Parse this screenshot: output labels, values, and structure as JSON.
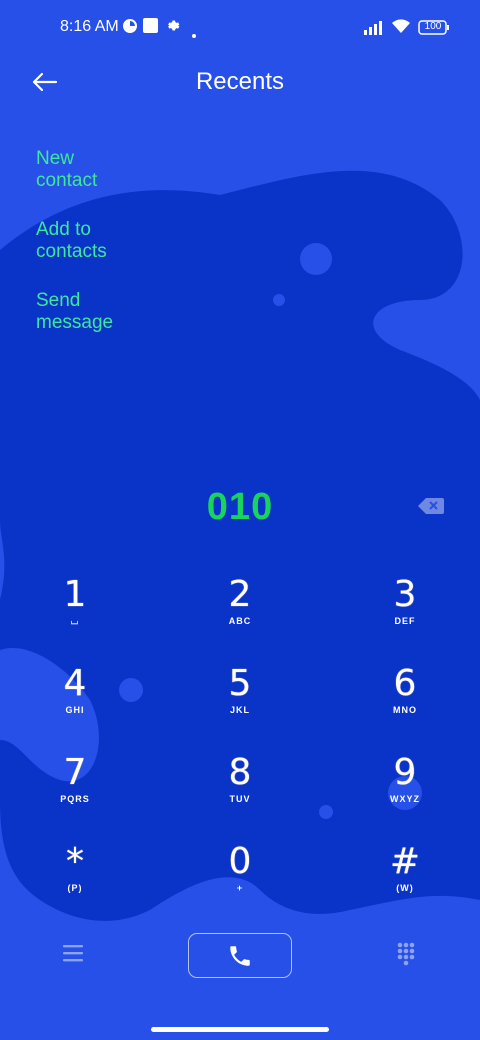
{
  "status_bar": {
    "time": "8:16 AM",
    "battery": "100"
  },
  "header": {
    "title": "Recents"
  },
  "menu": [
    {
      "label": "New contact"
    },
    {
      "label": "Add to contacts"
    },
    {
      "label": "Send message"
    }
  ],
  "dialer": {
    "number": "010",
    "keys": [
      {
        "digit": "1",
        "letters": "⌴"
      },
      {
        "digit": "2",
        "letters": "ABC"
      },
      {
        "digit": "3",
        "letters": "DEF"
      },
      {
        "digit": "4",
        "letters": "GHI"
      },
      {
        "digit": "5",
        "letters": "JKL"
      },
      {
        "digit": "6",
        "letters": "MNO"
      },
      {
        "digit": "7",
        "letters": "PQRS"
      },
      {
        "digit": "8",
        "letters": "TUV"
      },
      {
        "digit": "9",
        "letters": "WXYZ"
      },
      {
        "digit": "*",
        "letters": "(P)"
      },
      {
        "digit": "0",
        "letters": "+"
      },
      {
        "digit": "#",
        "letters": "(W)"
      }
    ]
  },
  "colors": {
    "background": "#2650e8",
    "wave": "#0a33c8",
    "accent_text": "#3ee89a",
    "number": "#19d45c"
  },
  "icons": [
    "back-arrow-icon",
    "backspace-icon",
    "menu-lines-icon",
    "phone-icon",
    "dialpad-icon"
  ]
}
